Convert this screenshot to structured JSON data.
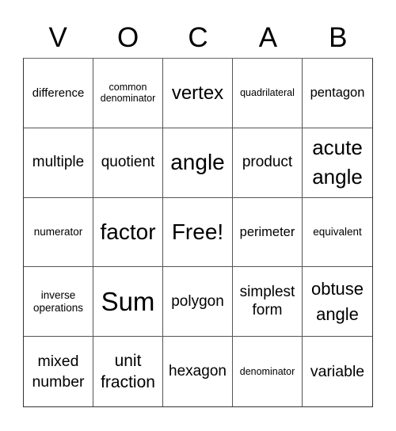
{
  "card": {
    "header_letters": [
      "V",
      "O",
      "C",
      "A",
      "B"
    ],
    "rows": [
      [
        "difference",
        "common denominator",
        "vertex",
        "quadrilateral",
        "pentagon"
      ],
      [
        "multiple",
        "quotient",
        "angle",
        "product",
        "acute angle"
      ],
      [
        "numerator",
        "factor",
        "Free!",
        "perimeter",
        "equivalent"
      ],
      [
        "inverse operations",
        "Sum",
        "polygon",
        "simplest form",
        "obtuse angle"
      ],
      [
        "mixed number",
        "unit fraction",
        "hexagon",
        "denominator",
        "variable"
      ]
    ]
  },
  "colors": {
    "border": "#333333",
    "text": "#000000",
    "background": "#ffffff"
  }
}
